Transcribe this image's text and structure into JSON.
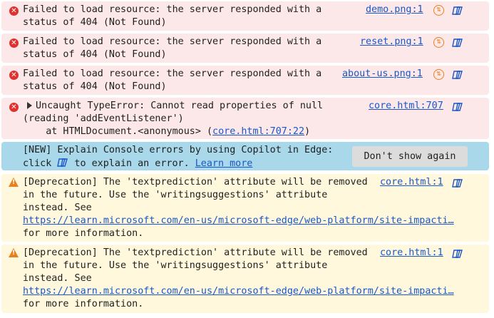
{
  "messages": [
    {
      "type": "error",
      "line1": "Failed to load resource: the server responded with a",
      "line2": "status of 404 (Not Found)",
      "source": "demo.png:1"
    },
    {
      "type": "error",
      "line1": "Failed to load resource: the server responded with a",
      "line2": "status of 404 (Not Found)",
      "source": "reset.png:1"
    },
    {
      "type": "error",
      "line1": "Failed to load resource: the server responded with a",
      "line2": "status of 404 (Not Found)",
      "source": "about-us.png:1"
    },
    {
      "type": "error",
      "line1": "Uncaught TypeError: Cannot read properties of null",
      "line2": "(reading 'addEventListener')",
      "line3_prefix": "    at HTMLDocument.<anonymous> (",
      "line3_link": "core.html:707:22",
      "line3_suffix": ")",
      "source": "core.html:707"
    }
  ],
  "copilot_banner": {
    "line1": "[NEW] Explain Console errors by using Copilot in Edge:",
    "line2_prefix": "click",
    "line2_suffix": " to explain an error.",
    "learn_more": "Learn more",
    "dismiss_label": "Don't show again"
  },
  "warnings": [
    {
      "line1": "[Deprecation] The 'textprediction' attribute will be removed",
      "line2": "in the future. Use the 'writingsuggestions' attribute",
      "line3": "instead. See",
      "url": "https://learn.microsoft.com/en-us/microsoft-edge/web-platform/site-impacti…",
      "line5": "for more information.",
      "source": "core.html:1"
    },
    {
      "line1": "[Deprecation] The 'textprediction' attribute will be removed",
      "line2": "in the future. Use the 'writingsuggestions' attribute",
      "line3": "instead. See",
      "url": "https://learn.microsoft.com/en-us/microsoft-edge/web-platform/site-impacti…",
      "line5": "for more information.",
      "source": "core.html:1"
    }
  ],
  "icons": {
    "error": "error-circle-icon",
    "warning": "warning-triangle-icon",
    "network": "network-request-icon",
    "copilot": "copilot-explain-icon"
  }
}
